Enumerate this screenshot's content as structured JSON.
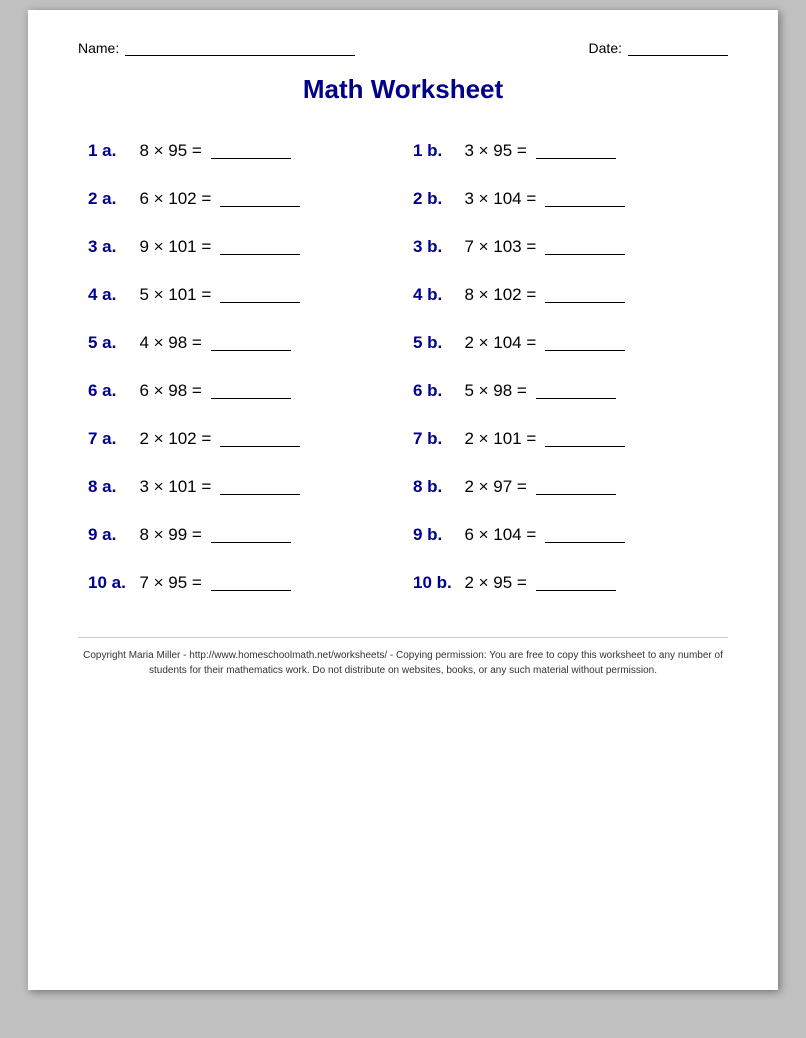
{
  "header": {
    "name_label": "Name:",
    "date_label": "Date:"
  },
  "title": "Math Worksheet",
  "problems": [
    {
      "id": "1 a.",
      "expr": "8  ×  95  ="
    },
    {
      "id": "1 b.",
      "expr": "3  ×  95  ="
    },
    {
      "id": "2 a.",
      "expr": "6  ×  102  ="
    },
    {
      "id": "2 b.",
      "expr": "3  ×  104  ="
    },
    {
      "id": "3 a.",
      "expr": "9  ×  101  ="
    },
    {
      "id": "3 b.",
      "expr": "7  ×  103  ="
    },
    {
      "id": "4 a.",
      "expr": "5  ×  101  ="
    },
    {
      "id": "4 b.",
      "expr": "8  ×  102  ="
    },
    {
      "id": "5 a.",
      "expr": "4  ×  98  ="
    },
    {
      "id": "5 b.",
      "expr": "2  ×  104  ="
    },
    {
      "id": "6 a.",
      "expr": "6  ×  98  ="
    },
    {
      "id": "6 b.",
      "expr": "5  ×  98  ="
    },
    {
      "id": "7 a.",
      "expr": "2  ×  102  ="
    },
    {
      "id": "7 b.",
      "expr": "2  ×  101  ="
    },
    {
      "id": "8 a.",
      "expr": "3  ×  101  ="
    },
    {
      "id": "8 b.",
      "expr": "2  ×  97  ="
    },
    {
      "id": "9 a.",
      "expr": "8  ×  99  ="
    },
    {
      "id": "9 b.",
      "expr": "6  ×  104  ="
    },
    {
      "id": "10 a.",
      "expr": "7  ×  95  ="
    },
    {
      "id": "10 b.",
      "expr": "2  ×  95  ="
    }
  ],
  "copyright": "Copyright Maria Miller - http://www.homeschoolmath.net/worksheets/ - Copying permission: You are free to copy this worksheet to any number of students for their mathematics work. Do not distribute on websites, books, or any such material without permission."
}
